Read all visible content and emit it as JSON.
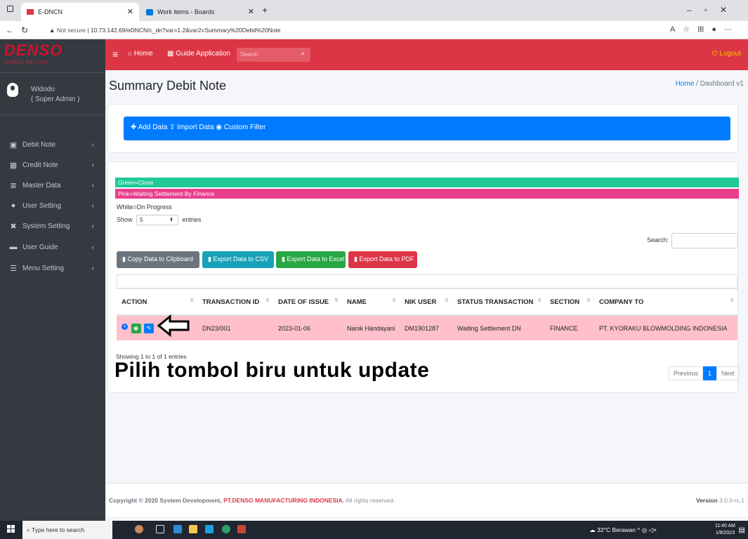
{
  "browser": {
    "tabs": [
      {
        "label": "E-DNCN"
      },
      {
        "label": "Work items - Boards"
      }
    ],
    "security": "Not secure",
    "url": "10.73.142.69/eDNCN/c_dn?var=1.2&var2=Summary%20Debit%20Note"
  },
  "sidebar": {
    "brand": "DENSO",
    "tagline": "Crafting the Core",
    "user_name": "Widodo",
    "user_role": "( Super Admin )",
    "items": [
      {
        "label": "Debit Note",
        "icon": "id-card-icon"
      },
      {
        "label": "Credit Note",
        "icon": "table-icon"
      },
      {
        "label": "Master Data",
        "icon": "database-icon"
      },
      {
        "label": "User Setting",
        "icon": "users-icon"
      },
      {
        "label": "System Setting",
        "icon": "tools-icon"
      },
      {
        "label": "User Guide",
        "icon": "book-icon"
      },
      {
        "label": "Menu Setting",
        "icon": "bars-icon"
      }
    ]
  },
  "navbar": {
    "home": "Home",
    "guide": "Guide Application",
    "search_placeholder": "Search",
    "logout": "Logout"
  },
  "page": {
    "title": "Summary Debit Note",
    "breadcrumb_home": "Home",
    "breadcrumb_current": "Dashboard v1"
  },
  "toolbar": {
    "add": "Add Data",
    "import": "Import Data",
    "filter": "Custom Filter"
  },
  "legend": {
    "green": "Green=Close",
    "pink": "Pink=Waiting Settlement By Finance",
    "white": "White=On Progress"
  },
  "table_controls": {
    "show": "Show",
    "entries_value": "5",
    "entries": "entries",
    "search_label": "Search:"
  },
  "export_buttons": {
    "copy": "Copy Data to Clipboard",
    "csv": "Export Data to CSV",
    "excel": "Export Data to Excel",
    "pdf": "Export Data to PDF"
  },
  "table": {
    "headers": [
      "ACTION",
      "TRANSACTION ID",
      "DATE OF ISSUE",
      "NAME",
      "NIK USER",
      "STATUS TRANSACTION",
      "SECTION",
      "COMPANY TO"
    ],
    "rows": [
      {
        "transaction_id": "DN23/001",
        "date": "2023-01-06",
        "name": "Nanik Handayani",
        "nik": "DM1901287",
        "status": "Waiting Settlement DN",
        "section": "FINANCE",
        "company": "PT. KYORAKU BLOWMOLDING INDONESIA"
      }
    ],
    "info": "Showing 1 to 1 of 1 entries",
    "prev": "Previous",
    "page": "1",
    "next": "Next"
  },
  "annotation": "Pilih tombol biru untuk update",
  "footer": {
    "copyright": "Copyright © 2020 System Development,",
    "company": "PT.DENSO MANUFACTURING INDONESIA.",
    "rights": "All rights reserved.",
    "version_label": "Version",
    "version": "3.0.0-rc.1"
  },
  "taskbar": {
    "search": "Type here to search",
    "weather": "32°C Berawan",
    "time": "11:40 AM",
    "date": "1/9/2023"
  },
  "colors": {
    "navbar": "#dc3545",
    "sidebar": "#343a40",
    "primary": "#007bff",
    "close_green": "#20c997",
    "waiting_pink": "#e83e8c",
    "row_pink": "#ffc0cb"
  }
}
